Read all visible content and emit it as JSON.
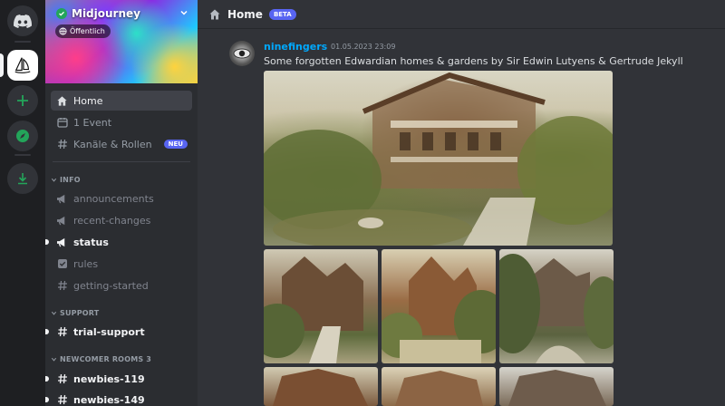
{
  "server": {
    "name": "Midjourney",
    "visibility": "Öffentlich"
  },
  "sidebar": {
    "nav": [
      {
        "label": "Home",
        "icon": "home-icon",
        "active": true
      },
      {
        "label": "1 Event",
        "icon": "calendar-icon"
      },
      {
        "label": "Kanäle & Rollen",
        "icon": "hashtag-icon",
        "badge": "NEU"
      }
    ],
    "categories": [
      {
        "name": "INFO",
        "channels": [
          {
            "label": "announcements",
            "icon": "megaphone-icon",
            "unread": false
          },
          {
            "label": "recent-changes",
            "icon": "megaphone-icon",
            "unread": false
          },
          {
            "label": "status",
            "icon": "megaphone-icon",
            "unread": true
          },
          {
            "label": "rules",
            "icon": "checkbox-icon",
            "unread": false
          },
          {
            "label": "getting-started",
            "icon": "hashtag-icon",
            "unread": false
          }
        ]
      },
      {
        "name": "SUPPORT",
        "channels": [
          {
            "label": "trial-support",
            "icon": "hashtag-icon",
            "unread": true
          }
        ]
      },
      {
        "name": "NEWCOMER ROOMS 3",
        "channels": [
          {
            "label": "newbies-119",
            "icon": "hashtag-icon",
            "unread": true
          },
          {
            "label": "newbies-149",
            "icon": "hashtag-icon",
            "unread": true
          }
        ]
      }
    ]
  },
  "header": {
    "title": "Home",
    "badge": "BETA"
  },
  "message": {
    "author": "ninefingers",
    "timestamp": "01.05.2023 23:09",
    "text": "Some forgotten Edwardian homes & gardens by Sir Edwin Lutyens & Gertrude Jekyll"
  },
  "colors": {
    "accent": "#5865f2",
    "author": "#00a8fc",
    "online": "#23a55a"
  }
}
